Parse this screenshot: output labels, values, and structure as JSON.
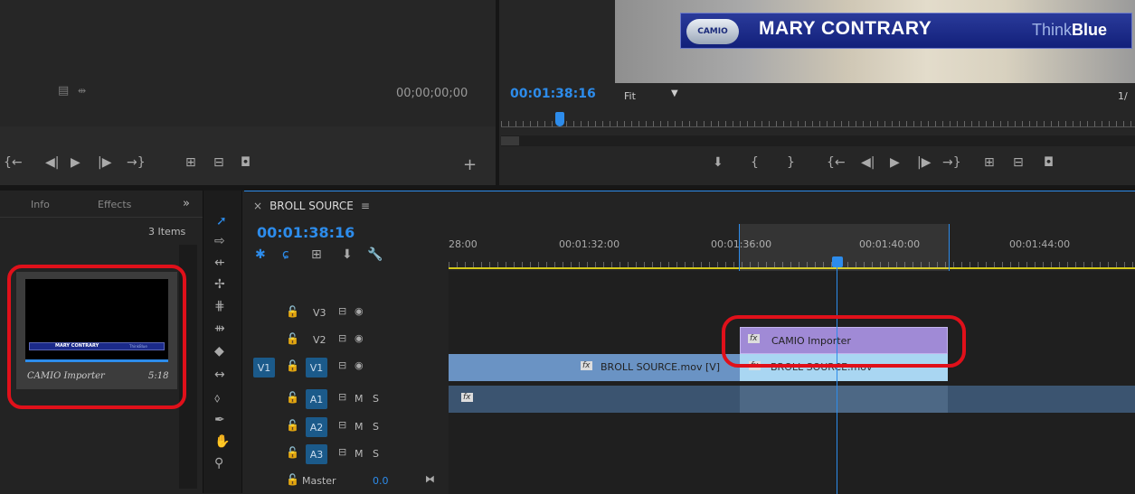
{
  "source_monitor": {
    "timecode": "00;00;00;00"
  },
  "program_monitor": {
    "timecode": "00:01:38:16",
    "fit_label": "Fit",
    "resolution_fragment": "1/",
    "lower_third": {
      "logo": "CAMIO",
      "name": "MARY CONTRARY",
      "brand_a": "Think",
      "brand_b": "Blue"
    }
  },
  "project_panel": {
    "tab_info": "Info",
    "tab_effects": "Effects",
    "overflow": "»",
    "items_count": "3 Items",
    "clip": {
      "name": "CAMIO Importer",
      "duration": "5:18",
      "thumb_name": "MARY CONTRARY",
      "thumb_brand": "ThinkBlue"
    }
  },
  "timeline": {
    "tab_title": "BROLL SOURCE",
    "close": "×",
    "menu": "≡",
    "timecode": "00:01:38:16",
    "ruler": [
      "28:00",
      "00:01:32:00",
      "00:01:36:00",
      "00:01:40:00",
      "00:01:44:00"
    ],
    "tracks": {
      "v3": "V3",
      "v2": "V2",
      "v1": "V1",
      "v1_src": "V1",
      "a1": "A1",
      "a2": "A2",
      "a3": "A3",
      "m": "M",
      "s": "S",
      "master": "Master",
      "master_val": "0.0"
    },
    "clips": {
      "camio": "CAMIO Importer",
      "broll": "BROLL SOURCE.mov [V]",
      "broll2": "BROLL SOURCE.mov",
      "fx": "fx"
    }
  },
  "colors": {
    "accent": "#2d8ceb",
    "annotation": "#e0101a",
    "camio_clip": "#a08ad6",
    "broll_clip": "#6a93c4"
  }
}
